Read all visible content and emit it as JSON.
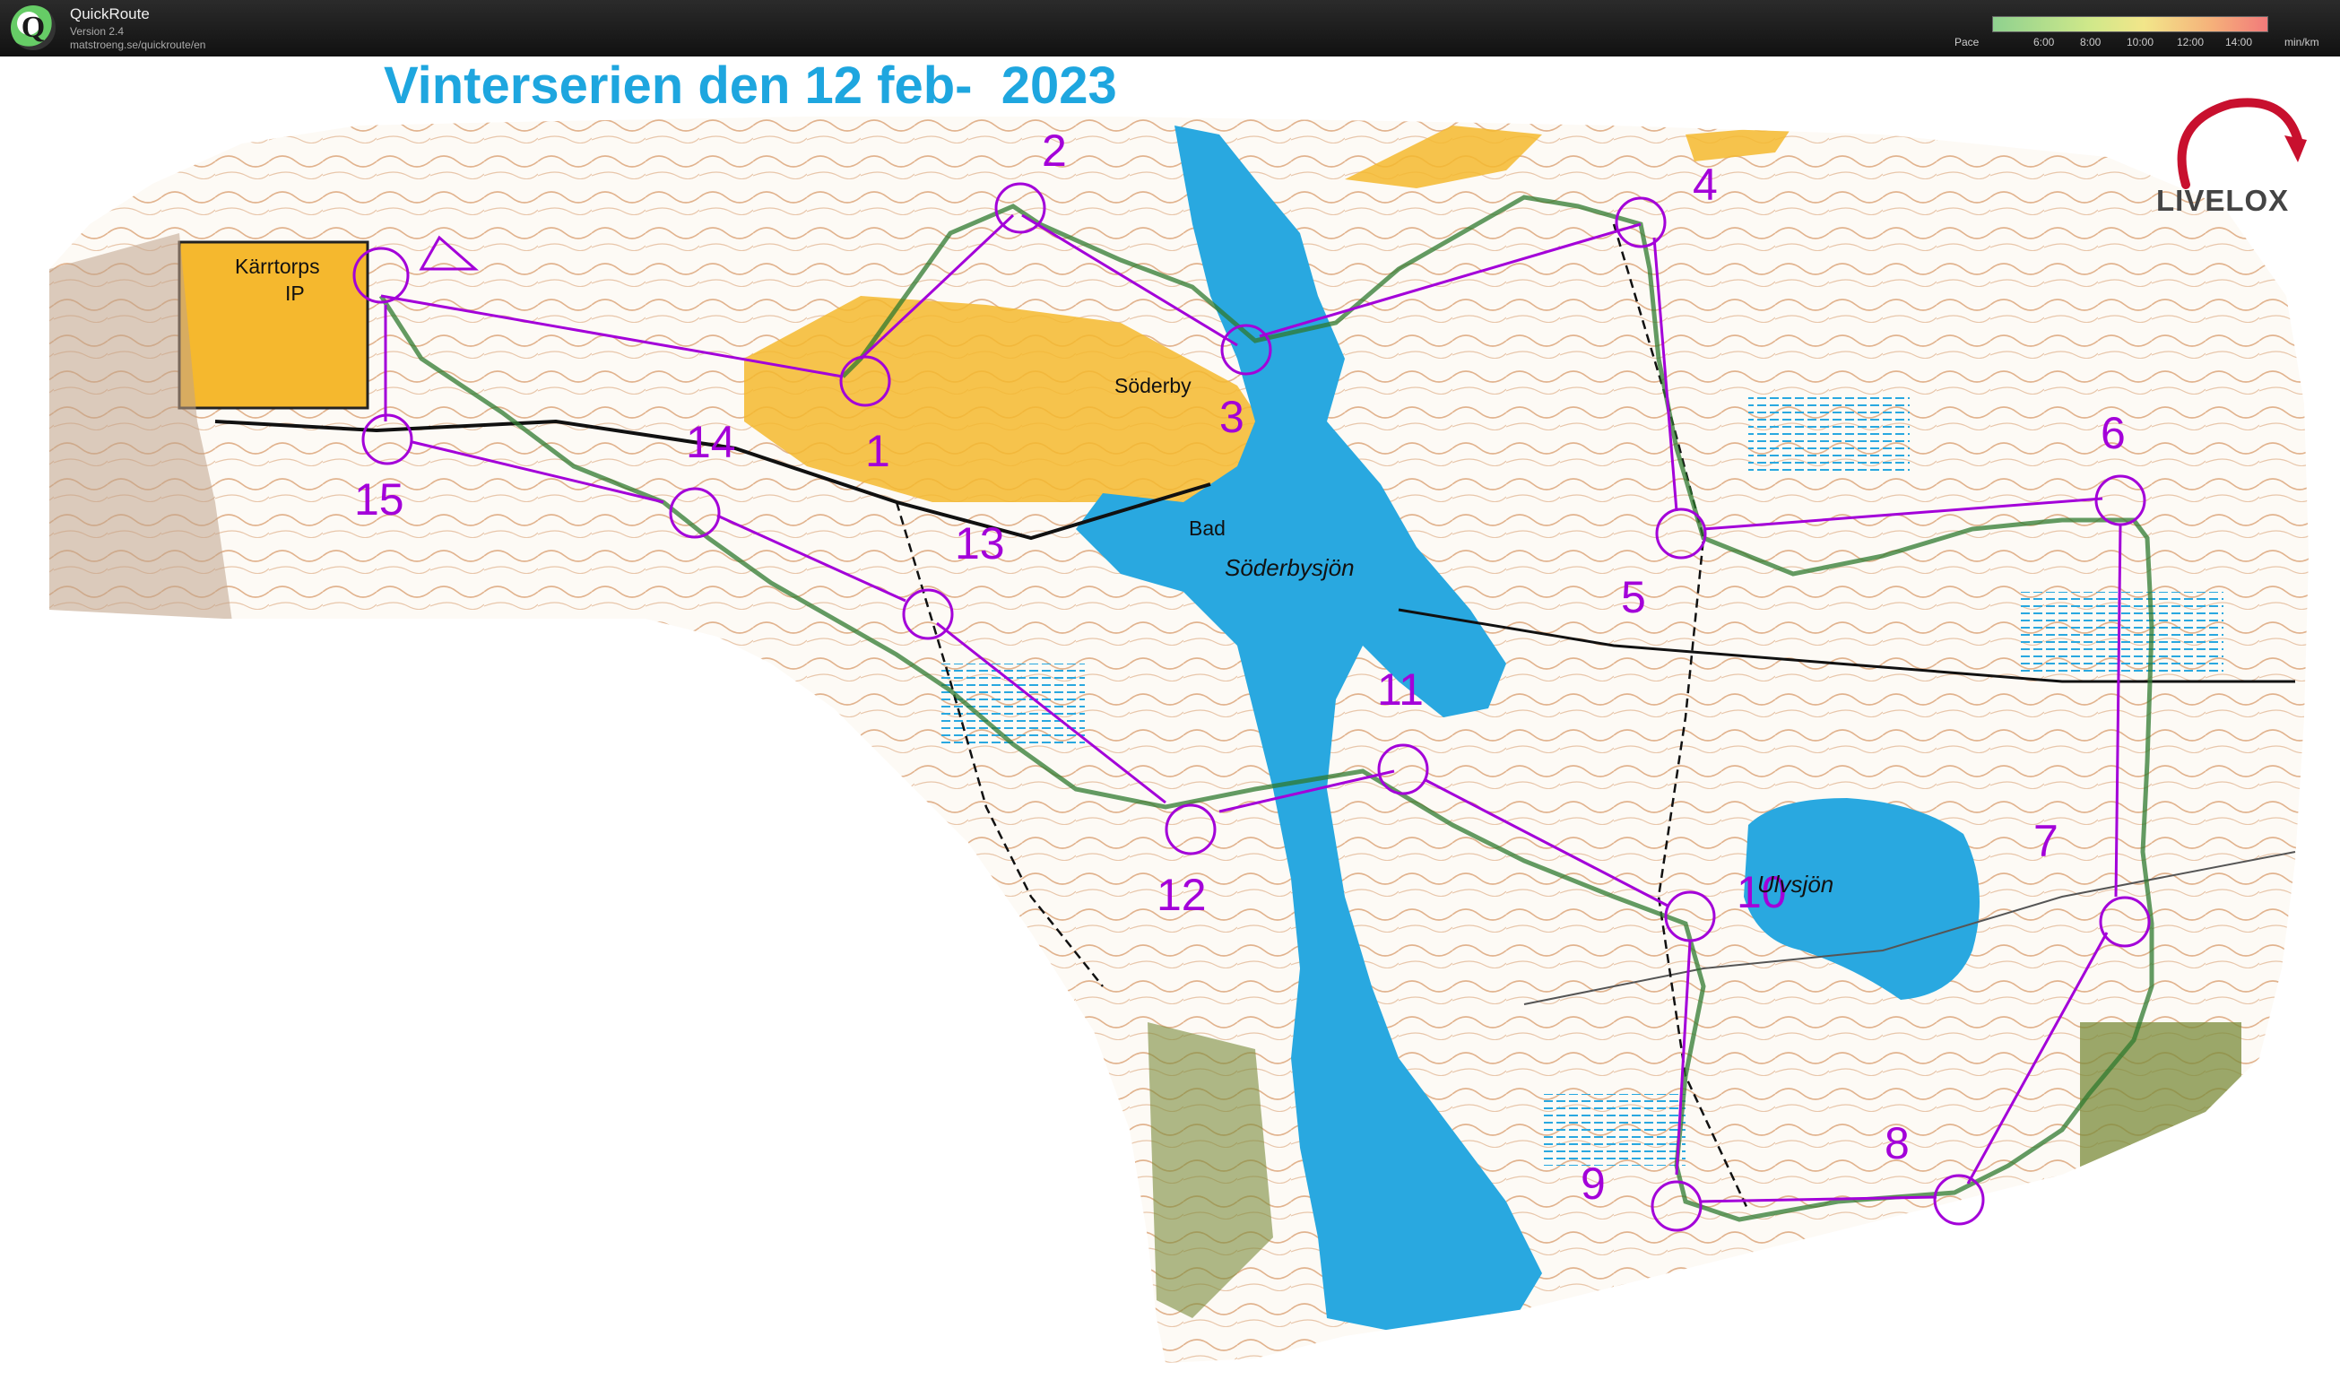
{
  "app": {
    "name": "QuickRoute",
    "version": "Version 2.4",
    "url": "matstroeng.se/quickroute/en"
  },
  "pace_scale": {
    "label": "Pace",
    "ticks": [
      "6:00",
      "8:00",
      "10:00",
      "12:00",
      "14:00"
    ],
    "unit": "min/km"
  },
  "map": {
    "title": "Vinterserien den 12 feb-  2023",
    "places": {
      "sports_ground_1": "Kärrtorps",
      "sports_ground_2": "IP",
      "village": "Söderby",
      "bath": "Bad",
      "lake_1": "Söderbysjön",
      "lake_2": "Ulvsjön"
    },
    "controls": [
      "1",
      "2",
      "3",
      "4",
      "5",
      "6",
      "7",
      "8",
      "9",
      "10",
      "11",
      "12",
      "13",
      "14",
      "15"
    ],
    "course_color": "#a300d9",
    "route_color": "#2f7a2f",
    "water_color": "#29a8e0",
    "open_land_color": "#f5b82e"
  },
  "brand": {
    "logo_text": "LIVELOX"
  }
}
